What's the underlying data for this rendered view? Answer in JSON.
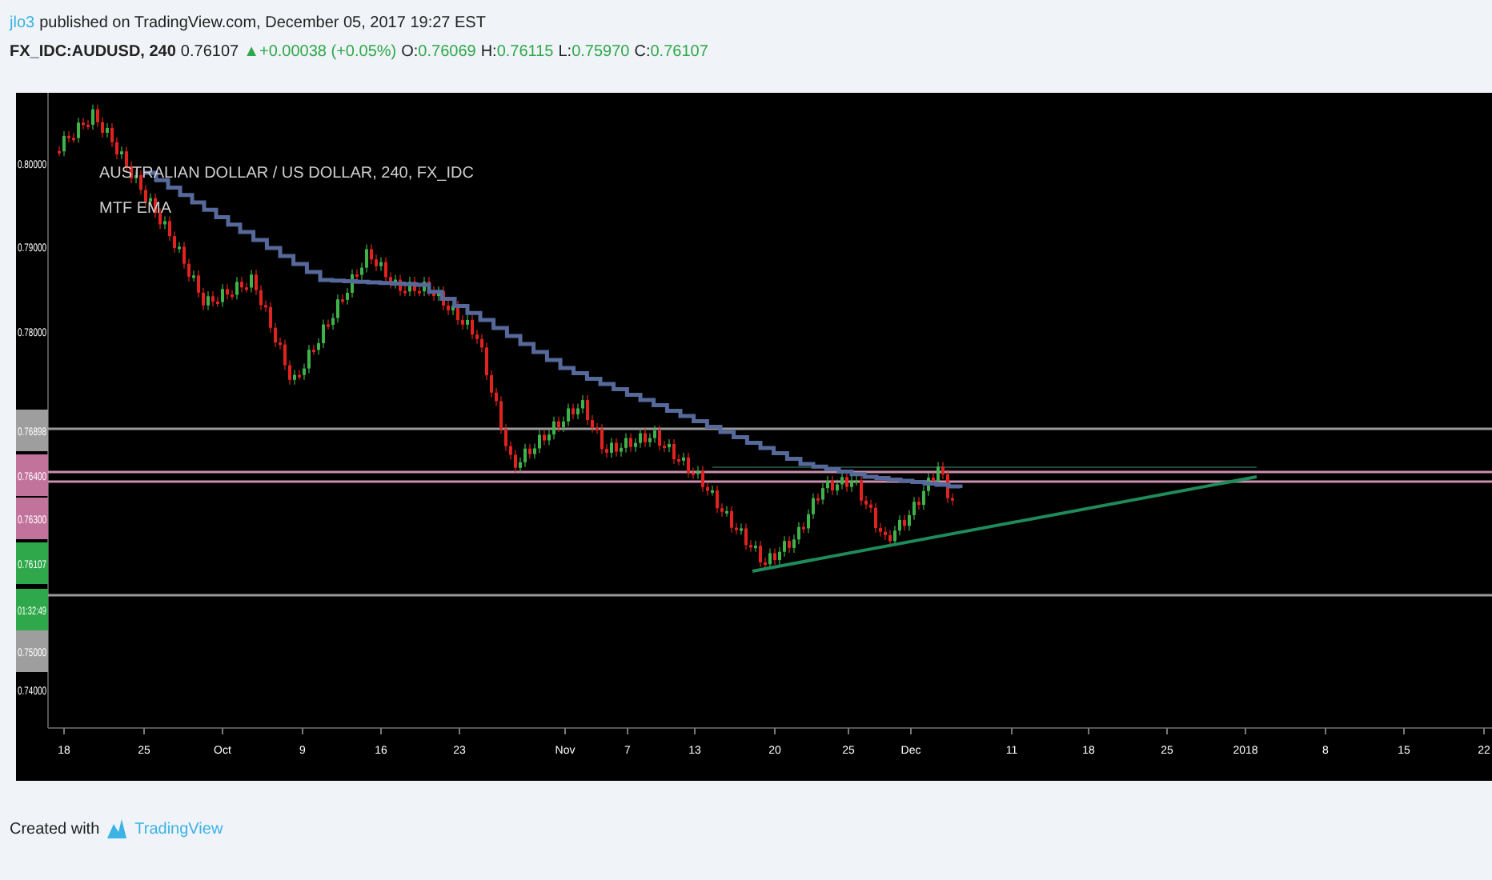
{
  "header": {
    "author": "jlo3",
    "published": "published on TradingView.com, December 05, 2017 19:27 EST",
    "symbol": "FX_IDC:AUDUSD, 240",
    "last": "0.76107",
    "change": "▲+0.00038 (+0.05%)",
    "ohlc": [
      {
        "label": "O:",
        "value": "0.76069"
      },
      {
        "label": "H:",
        "value": "0.76115"
      },
      {
        "label": "L:",
        "value": "0.75970"
      },
      {
        "label": "C:",
        "value": "0.76107"
      }
    ]
  },
  "chart": {
    "legend_title": "AUSTRALIAN DOLLAR / US DOLLAR, 240, FX_IDC",
    "indicator": "MTF EMA",
    "price_labels": [
      {
        "text": "0.80000"
      },
      {
        "text": "0.79000"
      },
      {
        "text": "0.78000"
      },
      {
        "text": "0.76898",
        "color": "#9e9e9e"
      },
      {
        "text": "0.76400",
        "color": "#c2739c"
      },
      {
        "text": "0.76300",
        "color": "#c2739c"
      },
      {
        "text": "0.76107",
        "color": "#2ea84a"
      },
      {
        "text": "01:32:49",
        "color": "#2ea84a"
      },
      {
        "text": "0.75000",
        "color": "#9e9e9e"
      },
      {
        "text": "0.74000"
      }
    ],
    "time_labels": [
      "18",
      "25",
      "Oct",
      "9",
      "16",
      "23",
      "Nov",
      "7",
      "13",
      "20",
      "25",
      "Dec",
      "11",
      "18",
      "25",
      "2018",
      "8",
      "15",
      "22"
    ]
  },
  "footer": {
    "text": "Created with",
    "brand": "TradingView"
  }
}
